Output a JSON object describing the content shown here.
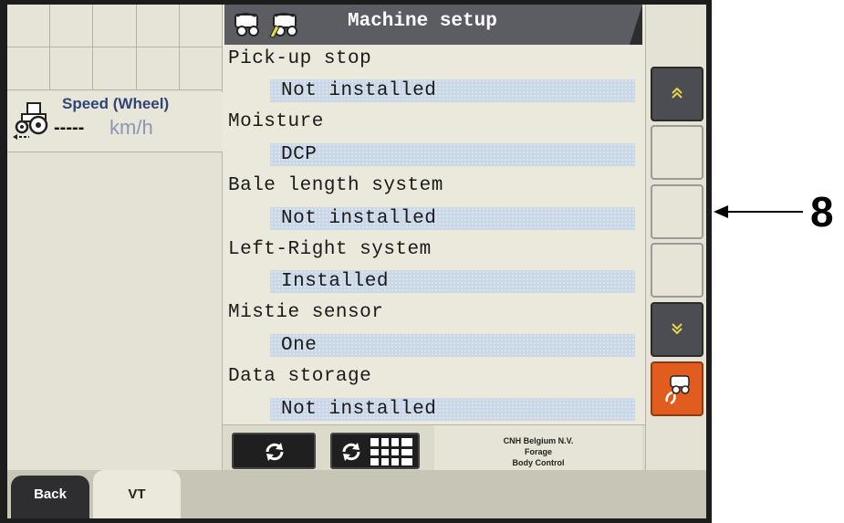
{
  "title": "Machine setup",
  "speed": {
    "label": "Speed (Wheel)",
    "value": "-----",
    "unit": "km/h"
  },
  "settings": [
    {
      "label": "Pick-up stop",
      "value": "Not installed"
    },
    {
      "label": "Moisture",
      "value": "DCP"
    },
    {
      "label": "Bale length system",
      "value": "Not installed"
    },
    {
      "label": "Left-Right system",
      "value": "Installed"
    },
    {
      "label": "Mistie sensor",
      "value": "One"
    },
    {
      "label": "Data storage",
      "value": "Not installed"
    }
  ],
  "company": {
    "line1": "CNH Belgium N.V.",
    "line2": "Forage",
    "line3": "Body Control"
  },
  "tabs": {
    "back": "Back",
    "vt": "VT"
  },
  "callout": "8",
  "colors": {
    "title_bar": "#5c5d63",
    "value_bg": "#c9d7e6",
    "softkey_orange": "#e05d1f",
    "softkey_dark": "#4c4d52",
    "chevron": "#e8d84a"
  },
  "icons": {
    "title_icons": [
      "baler-icon",
      "baler-settings-icon"
    ],
    "softkeys": [
      "scroll-up-icon",
      "scroll-down-icon",
      "baler-config-icon"
    ],
    "bottom_buttons": [
      "refresh-icon",
      "refresh-grid-icon"
    ]
  }
}
